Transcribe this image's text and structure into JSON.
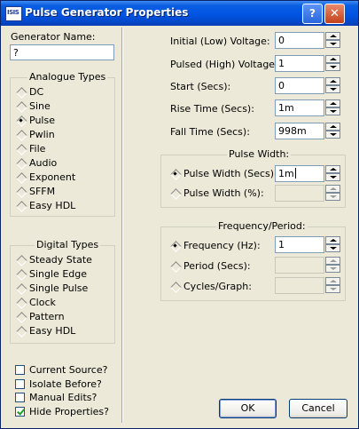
{
  "window": {
    "title": "Pulse Generator Properties",
    "app_icon": "ISIS",
    "help_label": "?",
    "close_label": "✕"
  },
  "generator_name": {
    "label": "Generator Name:",
    "value": "?"
  },
  "analogue_types": {
    "title": "Analogue Types",
    "items": [
      {
        "label": "DC",
        "selected": false
      },
      {
        "label": "Sine",
        "selected": false
      },
      {
        "label": "Pulse",
        "selected": true
      },
      {
        "label": "Pwlin",
        "selected": false
      },
      {
        "label": "File",
        "selected": false
      },
      {
        "label": "Audio",
        "selected": false
      },
      {
        "label": "Exponent",
        "selected": false
      },
      {
        "label": "SFFM",
        "selected": false
      },
      {
        "label": "Easy HDL",
        "selected": false
      }
    ]
  },
  "digital_types": {
    "title": "Digital Types",
    "items": [
      {
        "label": "Steady State",
        "selected": false
      },
      {
        "label": "Single Edge",
        "selected": false
      },
      {
        "label": "Single Pulse",
        "selected": false
      },
      {
        "label": "Clock",
        "selected": false
      },
      {
        "label": "Pattern",
        "selected": false
      },
      {
        "label": "Easy HDL",
        "selected": false
      }
    ]
  },
  "options": [
    {
      "label": "Current Source?",
      "checked": false
    },
    {
      "label": "Isolate Before?",
      "checked": false
    },
    {
      "label": "Manual Edits?",
      "checked": false
    },
    {
      "label": "Hide Properties?",
      "checked": true
    }
  ],
  "params": {
    "initial_voltage": {
      "label": "Initial (Low) Voltage:",
      "value": "0"
    },
    "pulsed_voltage": {
      "label": "Pulsed (High) Voltage:",
      "value": "1"
    },
    "start": {
      "label": "Start (Secs):",
      "value": "0"
    },
    "rise_time": {
      "label": "Rise Time (Secs):",
      "value": "1m"
    },
    "fall_time": {
      "label": "Fall Time (Secs):",
      "value": "998m"
    }
  },
  "pulse_width": {
    "title": "Pulse Width:",
    "secs": {
      "label": "Pulse Width (Secs):",
      "value": "1m",
      "selected": true
    },
    "percent": {
      "label": "Pulse Width (%):",
      "value": "",
      "selected": false
    }
  },
  "frequency_period": {
    "title": "Frequency/Period:",
    "frequency": {
      "label": "Frequency (Hz):",
      "value": "1",
      "selected": true
    },
    "period": {
      "label": "Period (Secs):",
      "value": "",
      "selected": false
    },
    "cycles": {
      "label": "Cycles/Graph:",
      "value": "",
      "selected": false
    }
  },
  "buttons": {
    "ok": "OK",
    "cancel": "Cancel"
  },
  "colors": {
    "titlebar": "#0054e3",
    "dialog_bg": "#ece9d8",
    "check": "#21a121"
  }
}
